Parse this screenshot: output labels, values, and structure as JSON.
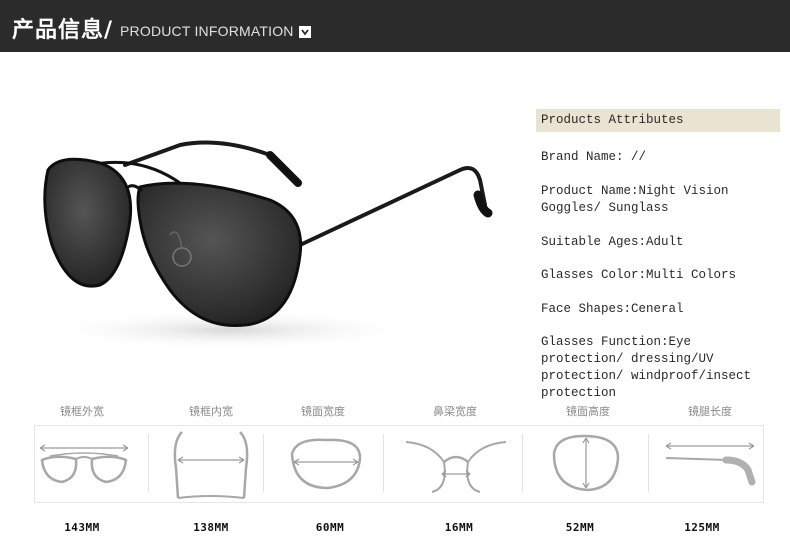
{
  "header": {
    "title_cn": "产品信息/",
    "title_en": "PRODUCT INFORMATION",
    "toggle_icon": "chevron-down-icon"
  },
  "product": {
    "image_subject": "aviator-sunglasses"
  },
  "attributes": {
    "header": "Products Attributes",
    "items": [
      "Brand Name:  //",
      "Product Name:Night Vision Goggles/ Sunglass",
      "Suitable Ages:Adult",
      "Glasses Color:Multi Colors",
      "Face Shapes:Ceneral",
      "Glasses Function:Eye protection/ dressing/UV protection/ windproof/insect protection"
    ]
  },
  "measurements": [
    {
      "label": "镜框外宽",
      "value": "143MM",
      "icon": "frame-width-icon"
    },
    {
      "label": "镜框内宽",
      "value": "138MM",
      "icon": "frame-inner-width-icon"
    },
    {
      "label": "镜面宽度",
      "value": "60MM",
      "icon": "lens-width-icon"
    },
    {
      "label": "鼻梁宽度",
      "value": "16MM",
      "icon": "bridge-width-icon"
    },
    {
      "label": "镜面高度",
      "value": "52MM",
      "icon": "lens-height-icon"
    },
    {
      "label": "镜腿长度",
      "value": "125MM",
      "icon": "temple-length-icon"
    }
  ],
  "colors": {
    "header_bg": "#2b2b2b",
    "attr_header_bg": "#e9e3d2"
  }
}
